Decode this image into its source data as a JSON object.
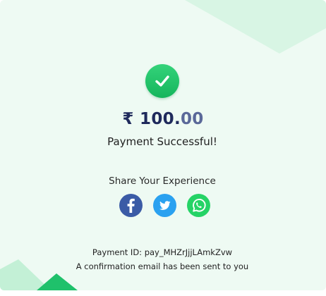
{
  "payment": {
    "currency_symbol": "₹",
    "amount_whole": "100.",
    "amount_fraction": "00",
    "status": "Payment Successful!",
    "id_line": "Payment ID: pay_MHZrJjjLAmkZvw",
    "confirmation": "A confirmation email has been sent to you"
  },
  "share": {
    "label": "Share Your Experience",
    "items": [
      {
        "name": "facebook",
        "icon": "facebook-icon",
        "color": "#3b5ba6"
      },
      {
        "name": "twitter",
        "icon": "twitter-icon",
        "color": "#2aa1f0"
      },
      {
        "name": "whatsapp",
        "icon": "whatsapp-icon",
        "color": "#25d366"
      }
    ]
  },
  "colors": {
    "background": "#eefaf3",
    "success": "#1fc16b",
    "amount": "#1f2a5c"
  }
}
